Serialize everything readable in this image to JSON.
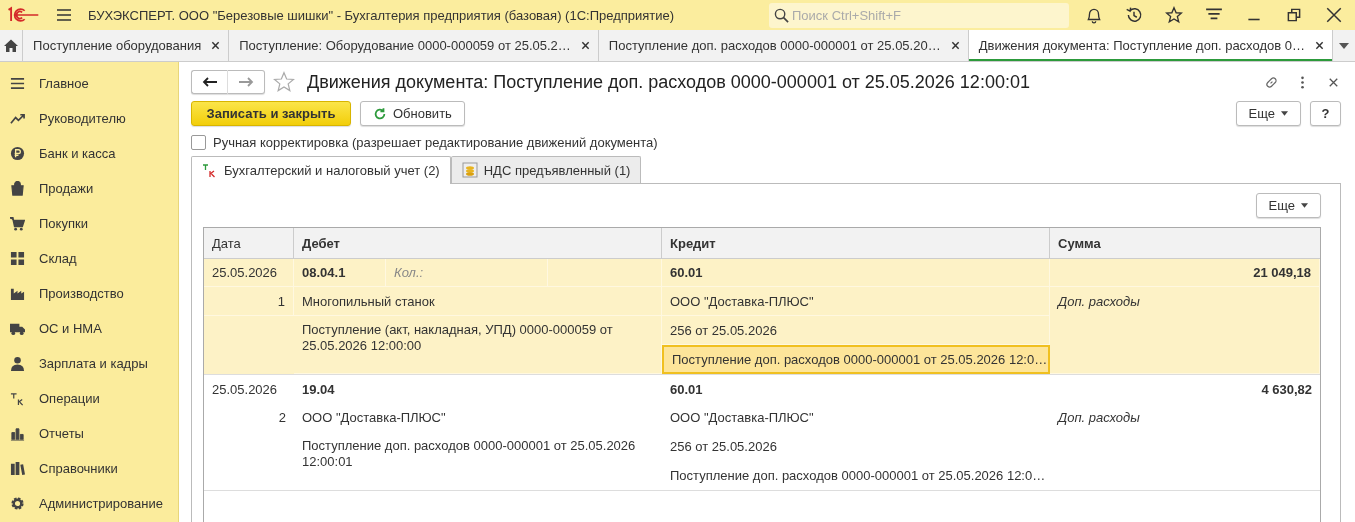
{
  "app": {
    "title": "БУХЭКСПЕРТ. ООО \"Березовые шишки\" - Бухгалтерия предприятия (базовая)  (1С:Предприятие)",
    "search": {
      "placeholder": "Поиск Ctrl+Shift+F"
    }
  },
  "open_tabs": [
    {
      "label": "Поступление оборудования",
      "selected": false
    },
    {
      "label": "Поступление: Оборудование 0000-000059 от 25.05.2…",
      "selected": false
    },
    {
      "label": "Поступление доп. расходов 0000-000001 от 25.05.20…",
      "selected": false
    },
    {
      "label": "Движения документа: Поступление доп. расходов 0…",
      "selected": true
    }
  ],
  "sidebar": {
    "items": [
      {
        "label": "Главное",
        "kind": "menu"
      },
      {
        "label": "Руководителю",
        "kind": "trend"
      },
      {
        "label": "Банк и касса",
        "kind": "coin"
      },
      {
        "label": "Продажи",
        "kind": "bag"
      },
      {
        "label": "Покупки",
        "kind": "cart"
      },
      {
        "label": "Склад",
        "kind": "grid"
      },
      {
        "label": "Производство",
        "kind": "factory"
      },
      {
        "label": "ОС и НМА",
        "kind": "truck"
      },
      {
        "label": "Зарплата и кадры",
        "kind": "person"
      },
      {
        "label": "Операции",
        "kind": "ledger"
      },
      {
        "label": "Отчеты",
        "kind": "bars"
      },
      {
        "label": "Справочники",
        "kind": "books"
      },
      {
        "label": "Администрирование",
        "kind": "gear"
      }
    ]
  },
  "form": {
    "title": "Движения документа: Поступление доп. расходов 0000-000001 от 25.05.2026 12:00:01",
    "buttons": {
      "save": "Записать и закрыть",
      "refresh": "Обновить",
      "more": "Еще",
      "help": "?"
    },
    "manual_edit": {
      "label": "Ручная корректировка (разрешает редактирование движений документа)",
      "checked": false
    },
    "tabs": [
      {
        "label": "Бухгалтерский и налоговый учет (2)",
        "kind": "ledger",
        "selected": true
      },
      {
        "label": "НДС предъявленный (1)",
        "kind": "coins",
        "selected": false
      }
    ],
    "panel": {
      "more": "Еще"
    },
    "table": {
      "columns": [
        "Дата",
        "Дебет",
        "Кредит",
        "Сумма"
      ],
      "rows": [
        {
          "date": "25.05.2026",
          "number": "1",
          "selected": true,
          "debit": {
            "account": "08.04.1",
            "quantity_label": "Кол.:",
            "lines": [
              "Многопильный станок",
              "Поступление (акт, накладная, УПД) 0000-000059 от 25.05.2026 12:00:00"
            ]
          },
          "credit": {
            "account": "60.01",
            "lines": [
              {
                "text": "ООО \"Доставка-ПЛЮС\"",
                "selected": false
              },
              {
                "text": "256 от 25.05.2026",
                "selected": false
              },
              {
                "text": "Поступление доп. расходов 0000-000001 от 25.05.2026 12:0…",
                "selected": true
              }
            ]
          },
          "amount": "21 049,18",
          "content": "Доп. расходы"
        },
        {
          "date": "25.05.2026",
          "number": "2",
          "selected": false,
          "debit": {
            "account": "19.04",
            "lines": [
              "ООО \"Доставка-ПЛЮС\"",
              "Поступление доп. расходов 0000-000001 от 25.05.2026 12:00:01"
            ]
          },
          "credit": {
            "account": "60.01",
            "lines": [
              {
                "text": "ООО \"Доставка-ПЛЮС\"",
                "selected": false
              },
              {
                "text": "256 от 25.05.2026",
                "selected": false
              },
              {
                "text": "Поступление доп. расходов 0000-000001 от 25.05.2026 12:0…",
                "selected": false
              }
            ]
          },
          "amount": "4 630,82",
          "content": "Доп. расходы"
        }
      ]
    }
  }
}
